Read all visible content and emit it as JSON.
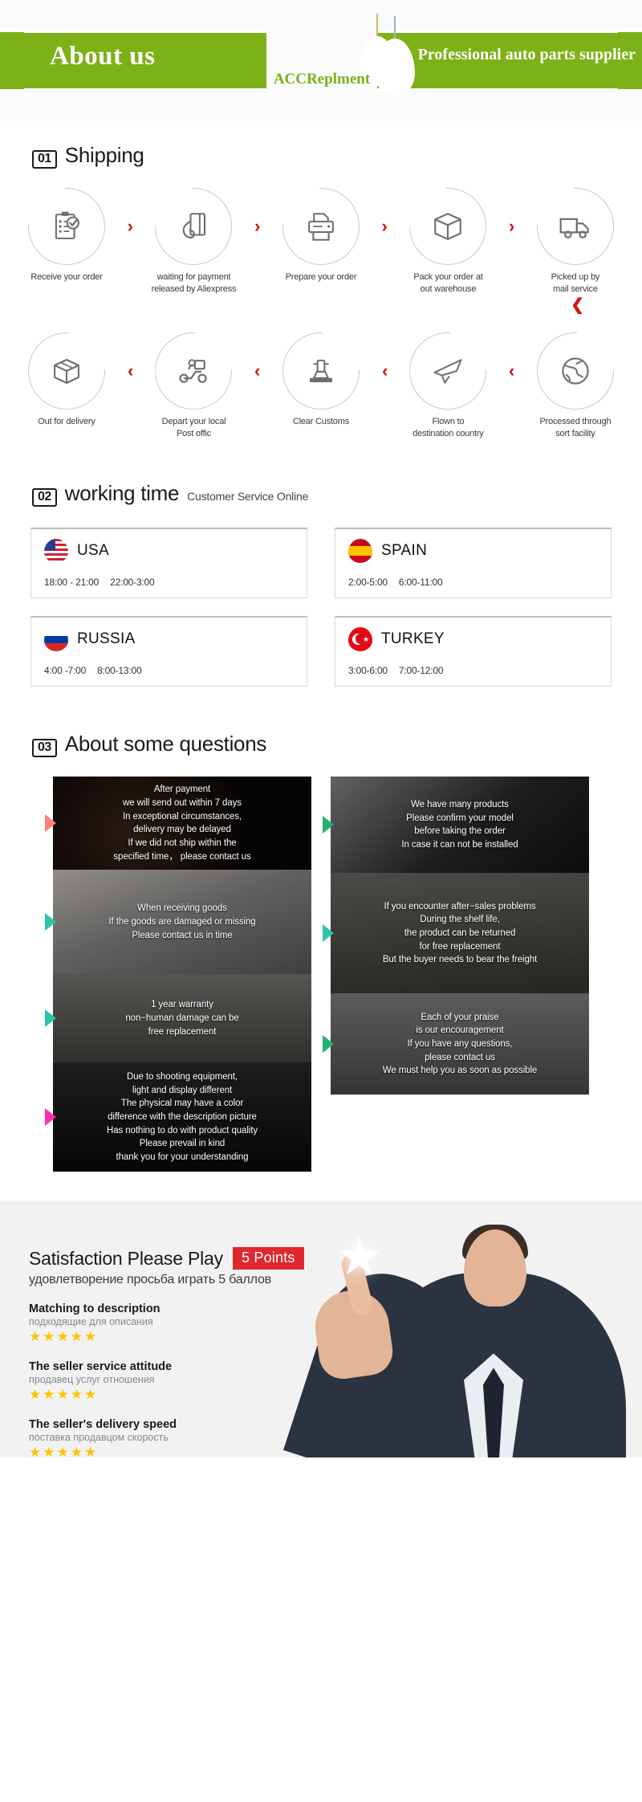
{
  "header": {
    "about_title": "About us",
    "supplier_title": "Professional auto parts supplier",
    "logo_text": "ACCReplment",
    "brand_green": "#7cb117"
  },
  "shipping": {
    "number": "01",
    "title": "Shipping",
    "chevron": "›",
    "chevron_down": "⌄",
    "row1": [
      {
        "icon": "clipboard-check-icon",
        "label": "Receive your order"
      },
      {
        "icon": "hand-card-icon",
        "label": "waiting for payment\nreleased by Aliexpress"
      },
      {
        "icon": "printer-icon",
        "label": "Prepare your order"
      },
      {
        "icon": "box-icon",
        "label": "Pack your order at\nout warehouse"
      },
      {
        "icon": "truck-icon",
        "label": "Picked up by\nmail service"
      }
    ],
    "row2": [
      {
        "icon": "open-box-icon",
        "label": "Out  for delivery"
      },
      {
        "icon": "scooter-delivery-icon",
        "label": "Depart your local\nPost offic"
      },
      {
        "icon": "customs-stamp-icon",
        "label": "Clear Customs"
      },
      {
        "icon": "airplane-icon",
        "label": "Flown to\ndestination country"
      },
      {
        "icon": "globe-icon",
        "label": "Processed through\nsort facility"
      }
    ]
  },
  "working_time": {
    "number": "02",
    "title": "working time",
    "subtitle": "Customer Service Online",
    "cards": [
      {
        "flag": "flag-usa-icon",
        "country": "USA",
        "times": [
          "18:00 - 21:00",
          "22:00-3:00"
        ]
      },
      {
        "flag": "flag-spain-icon",
        "country": "SPAIN",
        "times": [
          "2:00-5:00",
          "6:00-11:00"
        ]
      },
      {
        "flag": "flag-russia-icon",
        "country": "RUSSIA",
        "times": [
          "4:00 -7:00",
          "8:00-13:00"
        ]
      },
      {
        "flag": "flag-turkey-icon",
        "country": "TURKEY",
        "times": [
          "3:00-6:00",
          "7:00-12:00"
        ]
      }
    ]
  },
  "questions": {
    "number": "03",
    "title": "About some questions",
    "left_column": [
      "After payment\nwe will send out within 7 days\nIn exceptional circumstances,\ndelivery may be delayed\nIf we did not ship within the\nspecified time， please contact us",
      "When receiving goods\nIf the goods are damaged or missing\nPlease contact us in time",
      "1 year warranty\nnon−human damage can be\nfree replacement",
      "Due to shooting equipment,\nlight and display different\nThe physical may have a color\ndifference with the description picture\nHas nothing to do with product quality\nPlease prevail in kind\nthank you for your understanding"
    ],
    "right_column": [
      "We have many products\nPlease confirm your model\nbefore taking the order\nIn case it can not be installed",
      "If you encounter after−sales problems\nDuring the shelf life,\nthe product can be returned\nfor free replacement\nBut the buyer needs to bear the freight",
      "Each of your praise\nis our encouragement\nIf you have any questions,\nplease contact us\nWe must help you as soon as possible"
    ]
  },
  "satisfaction": {
    "title": "Satisfaction Please Play",
    "points_badge": "5 Points",
    "subtitle": "удовлетворение просьба играть 5 баллов",
    "badge_color": "#e0272f",
    "star_color": "#ffc400",
    "stars": "★★★★★",
    "items": [
      {
        "en": "Matching to description",
        "ru": "подходящие для описания"
      },
      {
        "en": "The seller service attitude",
        "ru": "продавец услуг отношения"
      },
      {
        "en": "The seller's delivery speed",
        "ru": "поставка продавцом скорость"
      }
    ]
  }
}
